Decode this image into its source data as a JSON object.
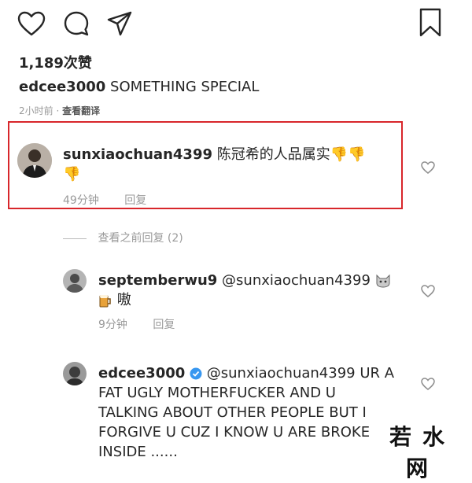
{
  "actions": {
    "icons": [
      "heart-icon",
      "comment-icon",
      "share-icon",
      "bookmark-icon"
    ]
  },
  "likes": "1,189次赞",
  "post": {
    "username": "edcee3000",
    "caption": "SOMETHING SPECIAL",
    "time": "2小时前",
    "dot": "·",
    "translate": "查看翻译"
  },
  "comments": [
    {
      "username": "sunxiaochuan4399",
      "text_line1": "陈冠希的人品属实",
      "emoji": "👎",
      "time": "49分钟",
      "reply": "回复"
    },
    {
      "username": "septemberwu9",
      "mention": "@sunxiaochuan4399",
      "text_line2": "嗷",
      "time": "9分钟",
      "reply": "回复"
    },
    {
      "username": "edcee3000",
      "mention": "@sunxiaochuan4399",
      "line1_tail": "UR A",
      "line2": "FAT UGLY MOTHERFUCKER AND U",
      "line3": "TALKING ABOUT OTHER PEOPLE BUT I",
      "line4": "FORGIVE U CUZ I KNOW U ARE BROKE",
      "line5": "INSIDE ......"
    }
  ],
  "view_previous_replies": "查看之前回复 (2)",
  "watermark": {
    "text": "若水网"
  },
  "colors": {
    "highlight": "#d8262b",
    "verified": "#3897f0",
    "text": "#262626",
    "muted": "#8e8e8e"
  }
}
